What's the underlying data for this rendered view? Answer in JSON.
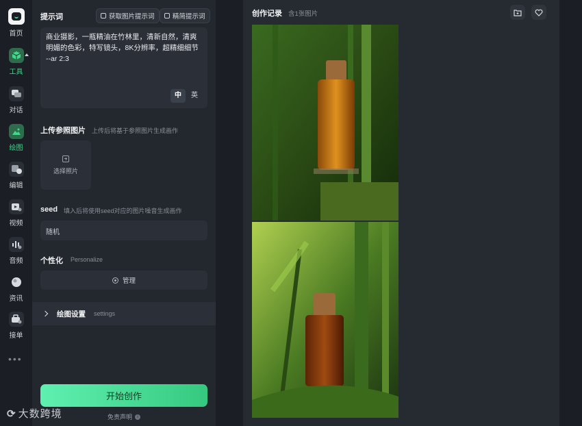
{
  "nav": {
    "items": [
      {
        "label": "首页"
      },
      {
        "label": "工具"
      },
      {
        "label": "对话"
      },
      {
        "label": "绘图"
      },
      {
        "label": "编辑"
      },
      {
        "label": "视频"
      },
      {
        "label": "音频"
      },
      {
        "label": "资讯"
      },
      {
        "label": "接单"
      }
    ],
    "more": "•••"
  },
  "prompt": {
    "label": "提示词",
    "get_prompt_button": "获取图片提示词",
    "refine_prompt_button": "精简提示词",
    "text": "商业摄影，一瓶精油在竹林里，清新自然，清爽明媚的色彩，特写镜头，8K分辨率，超精细细节 --ar 2:3",
    "lang_zh": "中",
    "lang_en": "英"
  },
  "reference": {
    "label": "上传参照图片",
    "hint": "上传后将基于参照图片生成画作",
    "upload_label": "选择照片"
  },
  "seed": {
    "label": "seed",
    "hint": "填入后将使用seed对应的图片噪音生成画作",
    "value": "随机"
  },
  "personalize": {
    "label": "个性化",
    "sub": "Personalize",
    "manage_label": "管理"
  },
  "settings": {
    "label": "绘图设置",
    "sub": "settings"
  },
  "start_button": "开始创作",
  "disclaimer": "免责声明",
  "records": {
    "title": "创作记录",
    "count": "含1张图片"
  },
  "watermark": {
    "text": "大数跨境"
  },
  "colors": {
    "accent": "#40d98a",
    "button_gradient_start": "#5ff0b0",
    "button_gradient_end": "#35c97f"
  }
}
